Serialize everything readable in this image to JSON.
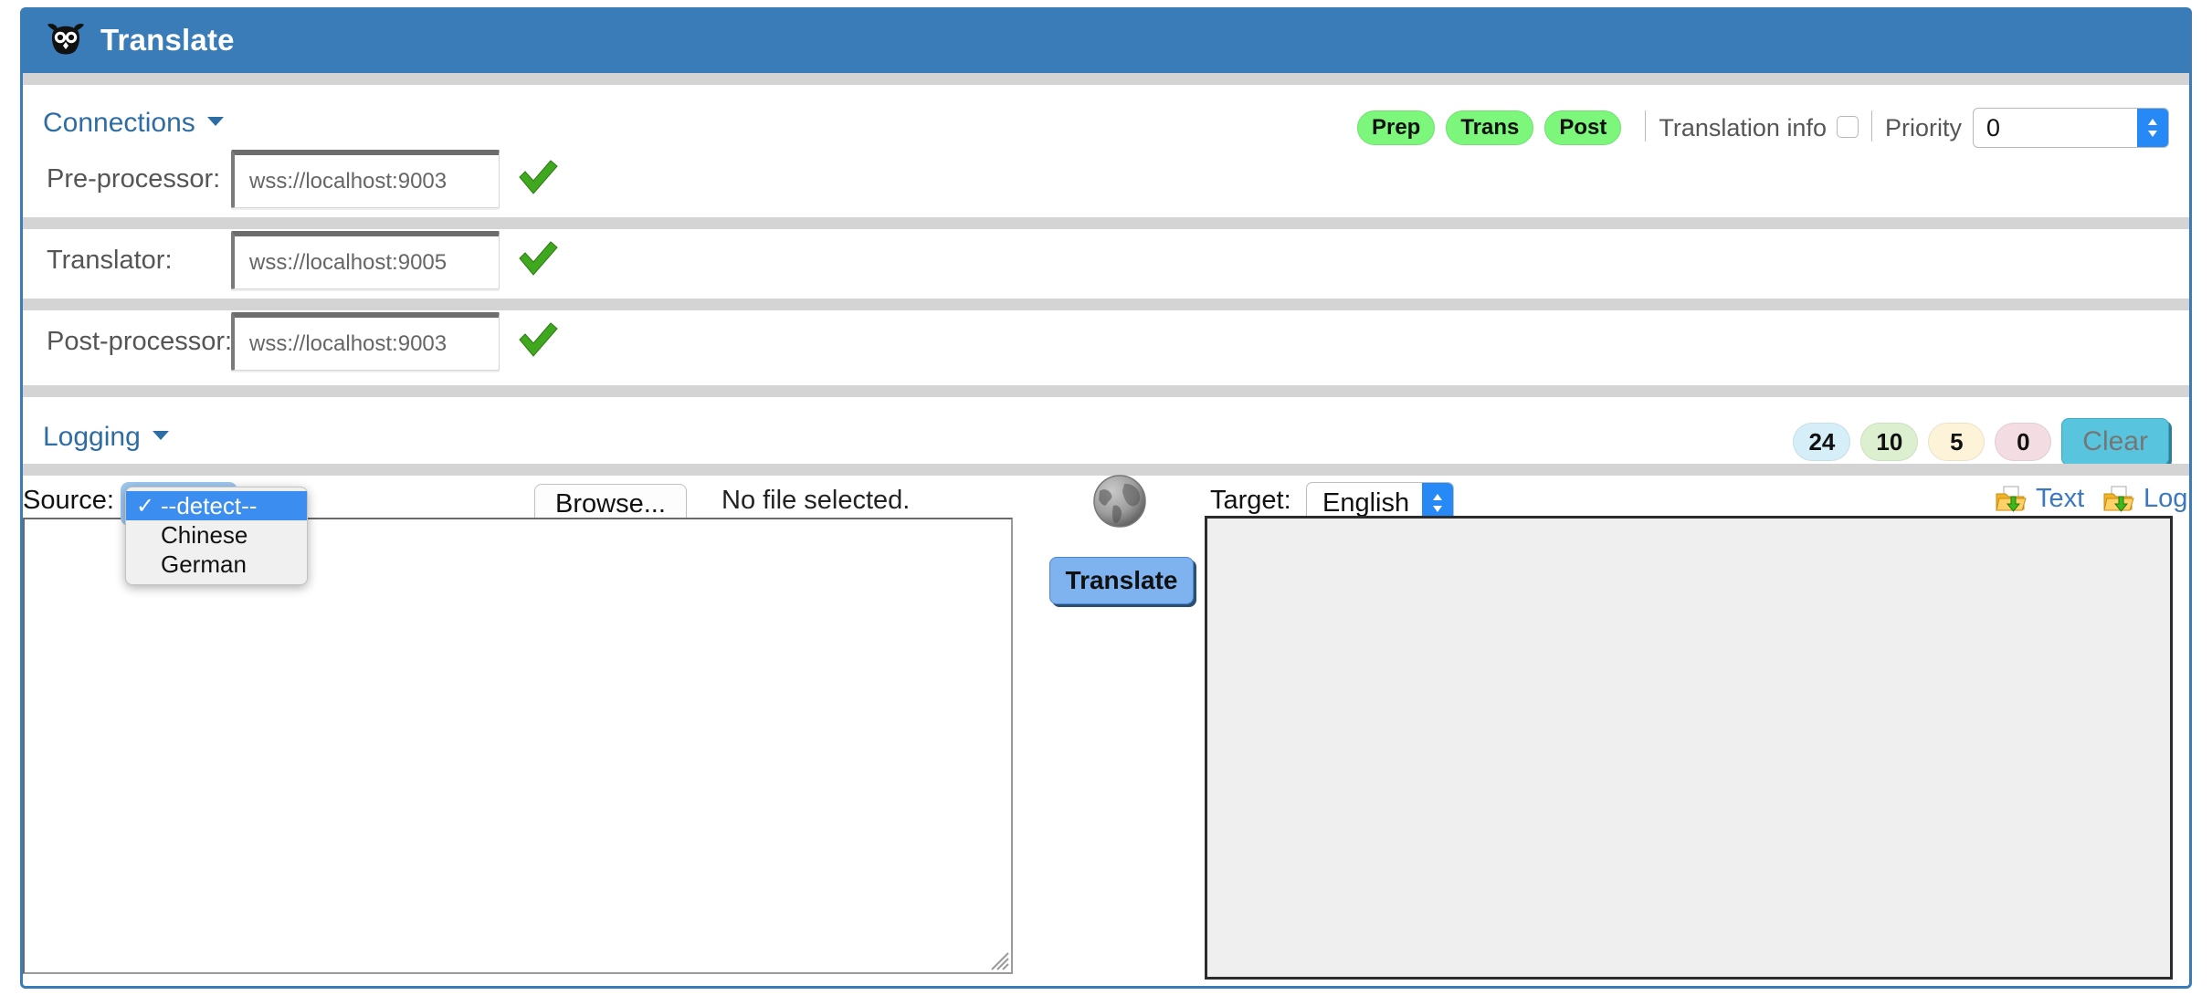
{
  "header": {
    "title": "Translate",
    "logo_icon": "owl-icon",
    "bg_color": "#3a7cb8"
  },
  "connections": {
    "section_label": "Connections",
    "status_pills": [
      {
        "label": "Prep",
        "color": "#7cf77c"
      },
      {
        "label": "Trans",
        "color": "#7cf77c"
      },
      {
        "label": "Post",
        "color": "#7cf77c"
      }
    ],
    "translation_info": {
      "label": "Translation info",
      "checked": false
    },
    "priority": {
      "label": "Priority",
      "value": "0"
    },
    "rows": [
      {
        "label": "Pre-processor:",
        "value": "wss://localhost:9003",
        "status_icon": "green-check-icon"
      },
      {
        "label": "Translator:",
        "value": "wss://localhost:9005",
        "status_icon": "green-check-icon"
      },
      {
        "label": "Post-processor:",
        "value": "wss://localhost:9003",
        "status_icon": "green-check-icon"
      }
    ]
  },
  "logging": {
    "section_label": "Logging",
    "badges": [
      {
        "value": "24",
        "color": "#d6eef8"
      },
      {
        "value": "10",
        "color": "#dcf0d0"
      },
      {
        "value": "5",
        "color": "#fcf3d9"
      },
      {
        "value": "0",
        "color": "#f3dde3"
      }
    ],
    "clear_button": "Clear"
  },
  "translation": {
    "source_label": "Source:",
    "source_dropdown": {
      "selected": "--detect--",
      "open": true,
      "options": [
        "--detect--",
        "Chinese",
        "German"
      ]
    },
    "browse_button": "Browse...",
    "file_status": "No file selected.",
    "globe_icon": "globe-icon",
    "translate_button": "Translate",
    "target_label": "Target:",
    "target_select": {
      "selected": "English"
    },
    "download_links": [
      {
        "label": "Text",
        "icon": "folder-download-icon"
      },
      {
        "label": "Log",
        "icon": "folder-download-icon"
      }
    ],
    "source_text": "",
    "target_text": ""
  }
}
